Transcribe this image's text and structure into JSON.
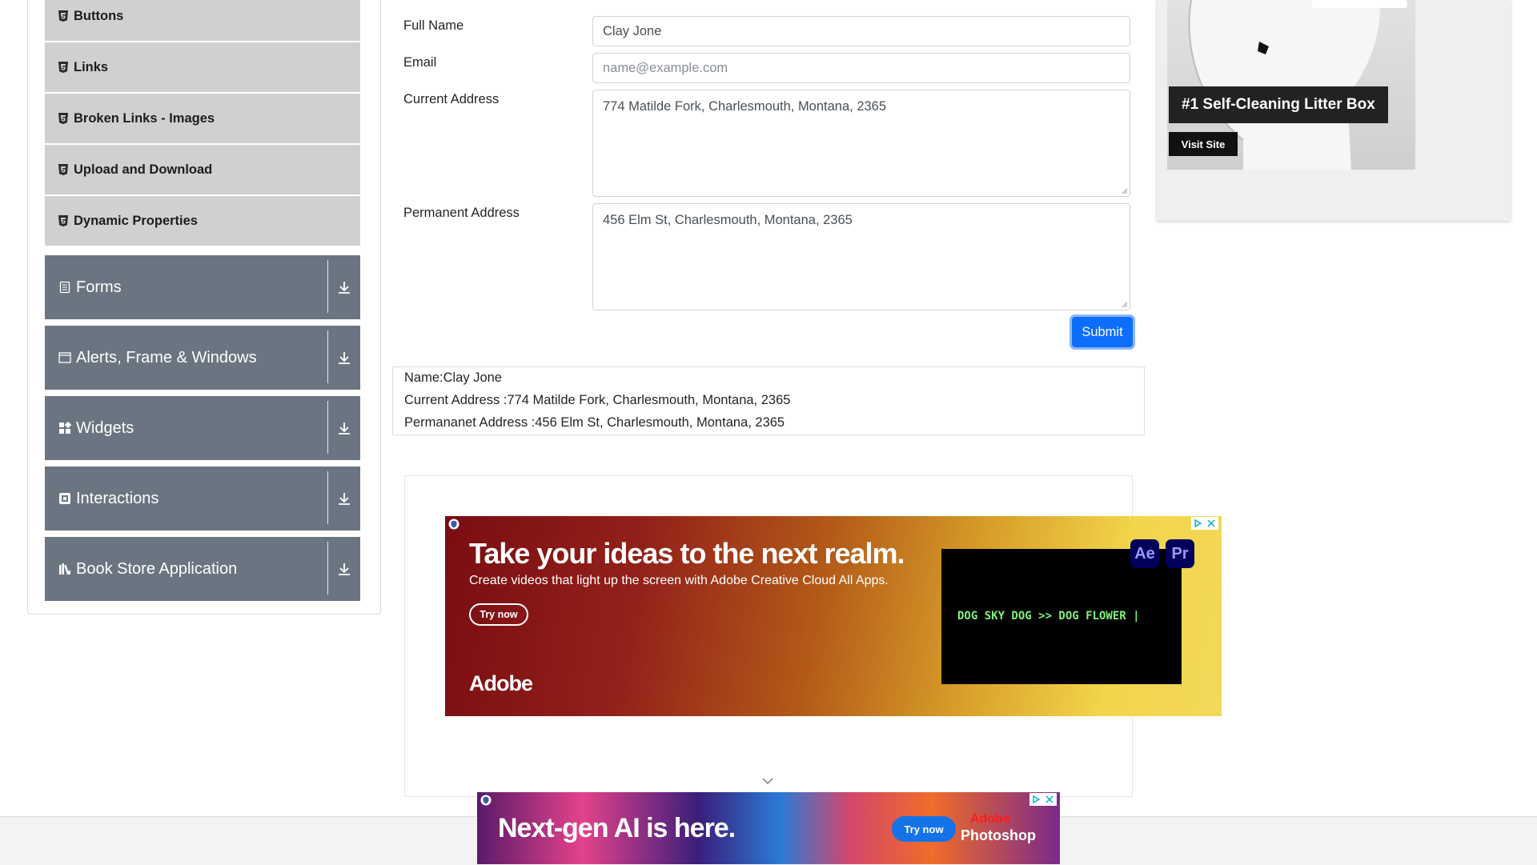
{
  "sidebar": {
    "subitems": [
      {
        "label": "Buttons",
        "icon": "html5-icon"
      },
      {
        "label": "Links",
        "icon": "html5-icon"
      },
      {
        "label": "Broken Links - Images",
        "icon": "html5-icon"
      },
      {
        "label": "Upload and Download",
        "icon": "html5-icon"
      },
      {
        "label": "Dynamic Properties",
        "icon": "html5-icon"
      }
    ],
    "groups": [
      {
        "label": "Forms",
        "icon": "document-icon"
      },
      {
        "label": "Alerts, Frame & Windows",
        "icon": "window-icon"
      },
      {
        "label": "Widgets",
        "icon": "widgets-icon"
      },
      {
        "label": "Interactions",
        "icon": "interaction-icon"
      },
      {
        "label": "Book Store Application",
        "icon": "books-icon"
      }
    ]
  },
  "form": {
    "full_name": {
      "label": "Full Name",
      "value": "Clay Jone"
    },
    "email": {
      "label": "Email",
      "value": "",
      "placeholder": "name@example.com"
    },
    "current_address": {
      "label": "Current Address",
      "value": "774 Matilde Fork, Charlesmouth, Montana, 2365"
    },
    "permanent_address": {
      "label": "Permanent Address",
      "value": "456 Elm St, Charlesmouth, Montana, 2365"
    },
    "submit_label": "Submit"
  },
  "output": {
    "name": "Name:Clay Jone",
    "current_address": "Current Address :774 Matilde Fork, Charlesmouth, Montana, 2365",
    "permanent_address": "Permananet Address :456 Elm St, Charlesmouth, Montana, 2365"
  },
  "ad_banner": {
    "headline": "Take your ideas to the next realm.",
    "subline": "Create videos that light up the screen with Adobe Creative Cloud All Apps.",
    "cta": "Try now",
    "brand": "Adobe",
    "video_text": "DOG SKY DOG >> DOG FLOWER |",
    "app_icons": [
      "Ae",
      "Pr"
    ],
    "colors": {
      "ae_text": "#9999ff",
      "pr_text": "#9999ff"
    }
  },
  "ad_bottom": {
    "headline": "Next-gen AI is here.",
    "cta": "Try now",
    "brand": "Adobe",
    "product": "Photoshop"
  },
  "side_ad": {
    "tagline": "#1 Self-Cleaning Litter Box",
    "cta": "Visit Site"
  },
  "colors": {
    "sidebar_group_bg": "#6b7581",
    "sidebar_subitem_bg": "#d0d0d0",
    "submit_bg": "#0d6efd"
  }
}
